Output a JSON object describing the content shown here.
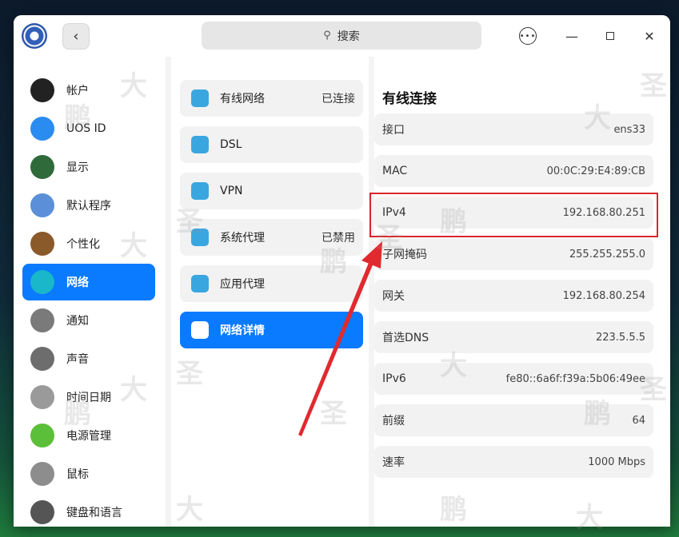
{
  "titlebar": {
    "search_placeholder": "搜索",
    "back_symbol": "‹",
    "menu_symbol": "•••",
    "minimize_symbol": "—",
    "close_symbol": "✕"
  },
  "sidebar": {
    "items": [
      {
        "label": "帐户",
        "icon": "user-avatar-icon",
        "color": "#222222"
      },
      {
        "label": "UOS ID",
        "icon": "cloud-icon",
        "color": "#2a8cf0"
      },
      {
        "label": "显示",
        "icon": "monitor-icon",
        "color": "#2f6b3a"
      },
      {
        "label": "默认程序",
        "icon": "default-apps-icon",
        "color": "#5b8fd8"
      },
      {
        "label": "个性化",
        "icon": "palette-icon",
        "color": "#8a5a2b"
      },
      {
        "label": "网络",
        "icon": "network-globe-icon",
        "color": "#19b7c9"
      },
      {
        "label": "通知",
        "icon": "bell-icon",
        "color": "#7a7a7a"
      },
      {
        "label": "声音",
        "icon": "speaker-icon",
        "color": "#6d6d6d"
      },
      {
        "label": "时间日期",
        "icon": "clock-icon",
        "color": "#9a9a9a"
      },
      {
        "label": "电源管理",
        "icon": "battery-icon",
        "color": "#5cbf3a"
      },
      {
        "label": "鼠标",
        "icon": "mouse-icon",
        "color": "#8d8d8d"
      },
      {
        "label": "键盘和语言",
        "icon": "keyboard-icon",
        "color": "#555555"
      }
    ]
  },
  "middle": {
    "items": [
      {
        "label": "有线网络",
        "status": "已连接",
        "icon": "wired-network-icon",
        "color": "#3aa6e0"
      },
      {
        "label": "DSL",
        "status": "",
        "icon": "dsl-icon",
        "color": "#3aa6e0"
      },
      {
        "label": "VPN",
        "status": "",
        "icon": "vpn-icon",
        "color": "#3aa6e0"
      },
      {
        "label": "系统代理",
        "status": "已禁用",
        "icon": "system-proxy-icon",
        "color": "#3aa6e0"
      },
      {
        "label": "应用代理",
        "status": "",
        "icon": "app-proxy-icon",
        "color": "#3aa6e0"
      },
      {
        "label": "网络详情",
        "status": "",
        "icon": "info-icon",
        "color": "#ffffff"
      }
    ]
  },
  "detail": {
    "title": "有线连接",
    "rows": [
      {
        "label": "接口",
        "value": "ens33"
      },
      {
        "label": "MAC",
        "value": "00:0C:29:E4:89:CB"
      },
      {
        "label": "IPv4",
        "value": "192.168.80.251"
      },
      {
        "label": "子网掩码",
        "value": "255.255.255.0"
      },
      {
        "label": "网关",
        "value": "192.168.80.254"
      },
      {
        "label": "首选DNS",
        "value": "223.5.5.5"
      },
      {
        "label": "IPv6",
        "value": "fe80::6a6f:f39a:5b06:49ee"
      },
      {
        "label": "前缀",
        "value": "64"
      },
      {
        "label": "速率",
        "value": "1000 Mbps"
      }
    ]
  },
  "watermark": {
    "chars": [
      "大",
      "鹏",
      "圣"
    ]
  },
  "colors": {
    "accent": "#0a7aff",
    "annotation": "#d9262b"
  }
}
